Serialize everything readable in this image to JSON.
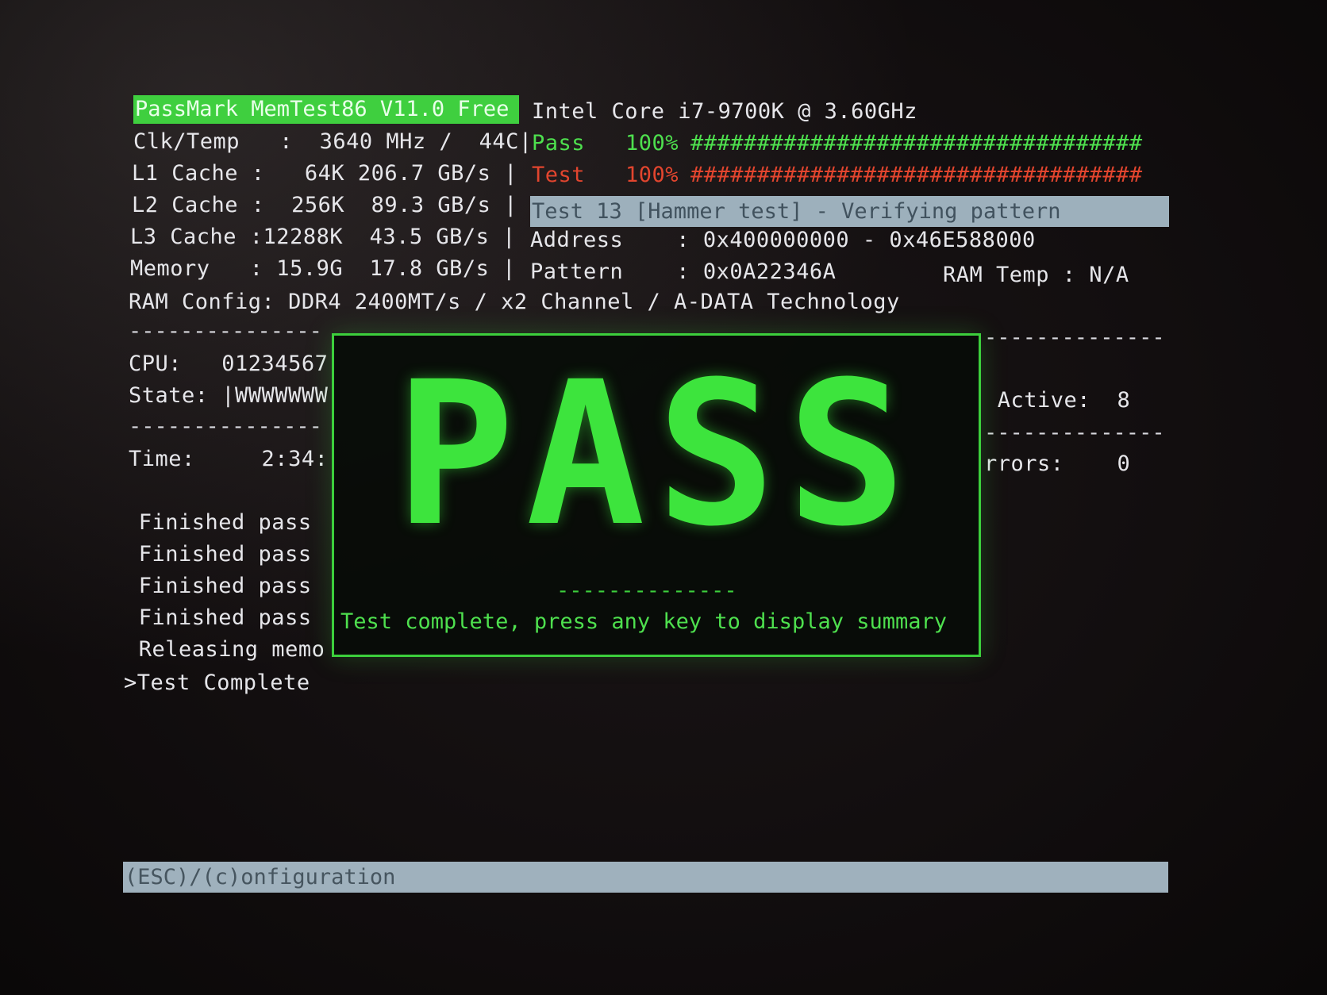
{
  "header": {
    "title": "PassMark MemTest86 V11.0 Free",
    "cpu_name": "Intel Core i7-9700K @ 3.60GHz"
  },
  "system": {
    "clk_temp": "Clk/Temp   :  3640 MHz /  44C|",
    "l1": "L1 Cache :   64K 206.7 GB/s |",
    "l2": "L2 Cache :  256K  89.3 GB/s |",
    "l3": "L3 Cache :12288K  43.5 GB/s |",
    "memory": "Memory   : 15.9G  17.8 GB/s |",
    "ram_config": "RAM Config: DDR4 2400MT/s / x2 Channel / A-DATA Technology"
  },
  "progress": {
    "pass_label": "Pass",
    "pass_pct": "100%",
    "pass_bar": "##################################",
    "test_label": "Test",
    "test_pct": "100%",
    "test_bar": "##################################",
    "current_test": "Test 13 [Hammer test] - Verifying pattern",
    "address": "Address    : 0x400000000 - 0x46E588000",
    "pattern": "Pattern    : 0x0A22346A",
    "ram_temp": "RAM Temp : N/A"
  },
  "left_panel": {
    "dash1": "---------------",
    "cpu": "CPU:   01234567",
    "state": "State: |WWWWWWW",
    "dash2": "---------------",
    "time": "Time:     2:34:",
    "log": [
      " Finished pass",
      " Finished pass",
      " Finished pass",
      " Finished pass",
      " Releasing memo",
      ">Test Complete"
    ]
  },
  "right_panel": {
    "dash1": "--------------",
    "active": " Active:  8",
    "dash2": "--------------",
    "errors": "rrors:    0"
  },
  "result": {
    "big_text": "PASS",
    "dash": "--------------",
    "message": "Test complete, press any key to display summary"
  },
  "footer": {
    "hint": "(ESC)/(c)onfiguration"
  }
}
